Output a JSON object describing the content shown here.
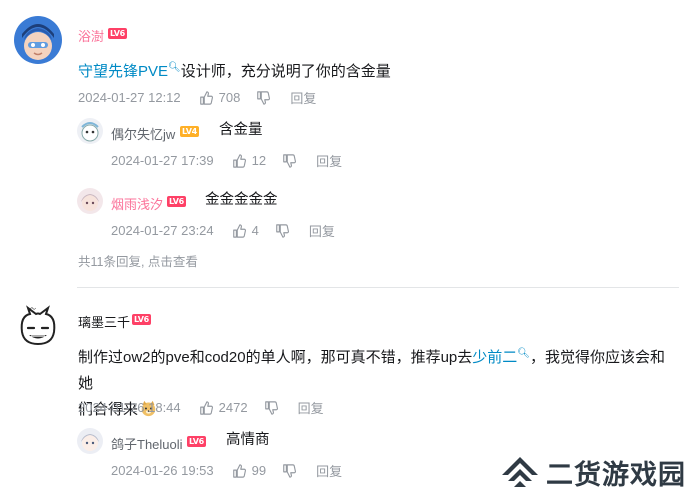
{
  "comments": [
    {
      "username": "浴澍",
      "level": "LV6",
      "content_link": "守望先锋PVE",
      "content_text": "设计师，充分说明了你的含金量",
      "time": "2024-01-27 12:12",
      "likes": "708",
      "reply_label": "回复",
      "replies": [
        {
          "username": "偶尔失忆jw",
          "level": "LV4",
          "text": "含金量",
          "time": "2024-01-27 17:39",
          "likes": "12",
          "reply_label": "回复"
        },
        {
          "username": "烟雨浅汐",
          "level": "LV6",
          "text": "金金金金金",
          "time": "2024-01-27 23:24",
          "likes": "4",
          "reply_label": "回复"
        }
      ],
      "more_replies": "共11条回复, 点击查看"
    },
    {
      "username": "璃墨三千",
      "level": "LV6",
      "content_part1": "制作过ow2的pve和cod20的单人啊，那可真不错，推荐up去",
      "content_link": "少前二",
      "content_part2": "，我觉得你应该会和她",
      "content_line2": "们合得来",
      "time": "2024-01-26 18:44",
      "likes": "2472",
      "reply_label": "回复",
      "replies": [
        {
          "username": "鸽子Theluoli",
          "level": "LV6",
          "text": "高情商",
          "time": "2024-01-26 19:53",
          "likes": "99",
          "reply_label": "回复"
        }
      ]
    }
  ],
  "watermark": "二货游戏园",
  "colors": {
    "accent_pink": "#fb7299",
    "link_blue": "#008ac5",
    "meta_gray": "#9499a0",
    "level_red": "#fe4066",
    "level_orange": "#ffb027"
  },
  "icons": [
    "thumb-up-icon",
    "thumb-down-icon",
    "search-icon",
    "doge-emoji-icon",
    "watermark-logo-icon"
  ]
}
